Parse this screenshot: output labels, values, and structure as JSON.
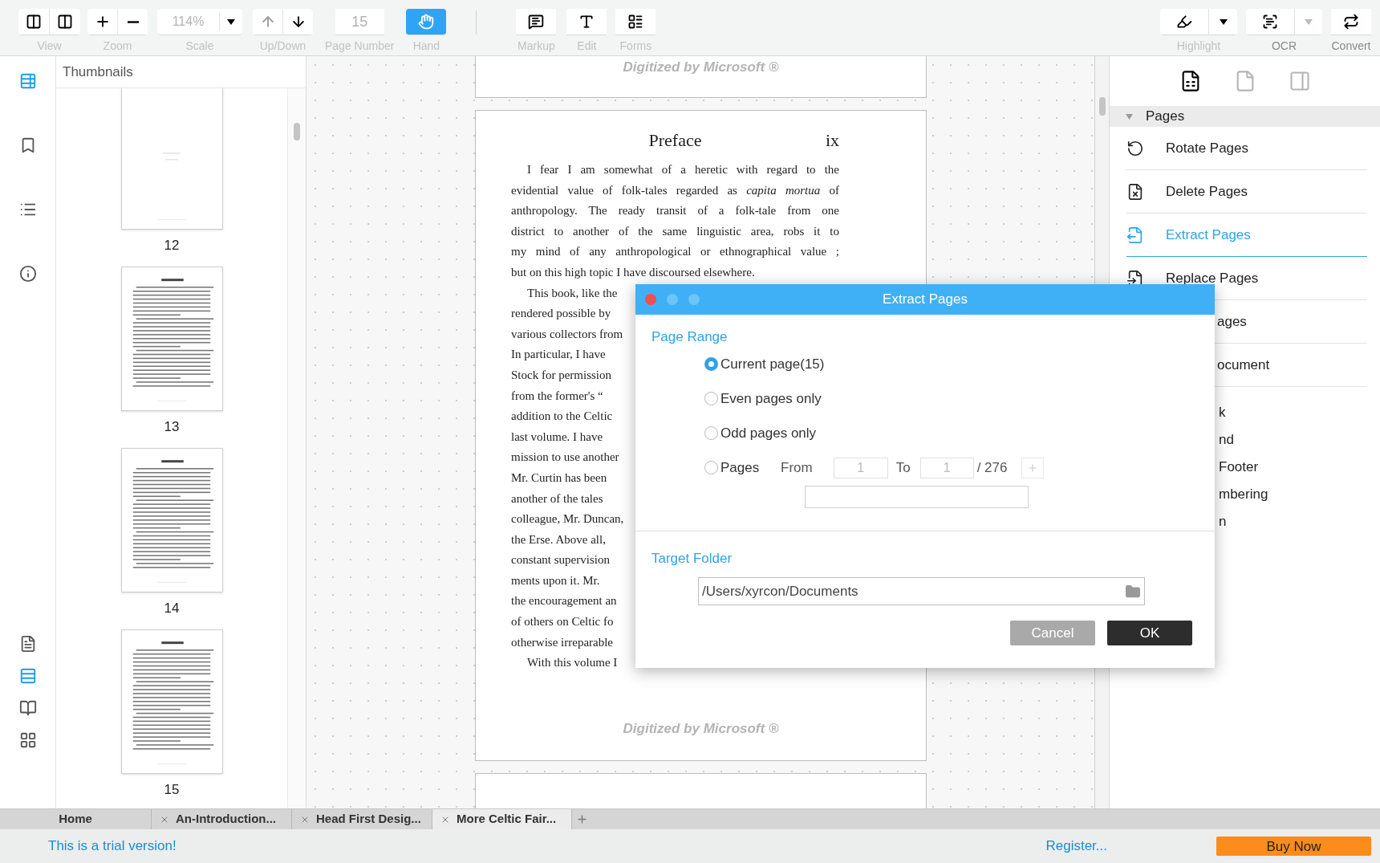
{
  "toolbar": {
    "left": [
      {
        "kind": "view",
        "label": "View",
        "disabled": true,
        "selected": false
      },
      {
        "kind": "zoom",
        "label": "Zoom",
        "disabled": true,
        "selected": false
      },
      {
        "kind": "scale",
        "label": "Scale",
        "value": "114%",
        "disabled": true,
        "selected": false
      },
      {
        "kind": "updown",
        "label": "Up/Down",
        "disabled": true,
        "selected": false
      },
      {
        "kind": "page",
        "label": "Page Number",
        "value": "15",
        "disabled": true,
        "selected": false
      },
      {
        "kind": "hand",
        "label": "Hand",
        "disabled": true,
        "selected": true
      }
    ],
    "middle": [
      {
        "kind": "markup",
        "label": "Markup",
        "disabled": true
      },
      {
        "kind": "edit",
        "label": "Edit",
        "disabled": true
      },
      {
        "kind": "forms",
        "label": "Forms",
        "disabled": true
      }
    ],
    "right": [
      {
        "kind": "highlight",
        "label": "Highlight",
        "disabled": true
      },
      {
        "kind": "ocr",
        "label": "OCR",
        "disabled": false
      },
      {
        "kind": "convert",
        "label": "Convert",
        "disabled": false
      }
    ]
  },
  "left_rail": {
    "top": [
      {
        "kind": "thumbnails",
        "selected": true
      },
      {
        "kind": "bookmarks",
        "selected": false
      },
      {
        "kind": "outline",
        "selected": false
      },
      {
        "kind": "info",
        "selected": false
      }
    ],
    "bottom": [
      {
        "kind": "single",
        "selected": false
      },
      {
        "kind": "continuous",
        "selected": true
      },
      {
        "kind": "facing",
        "selected": false
      },
      {
        "kind": "facing-continuous",
        "selected": false
      }
    ]
  },
  "thumbnails": {
    "title": "Thumbnails",
    "pages": [
      {
        "label": "12",
        "kind": "blank"
      },
      {
        "label": "13",
        "kind": "text"
      },
      {
        "label": "14",
        "kind": "text"
      },
      {
        "label": "15",
        "kind": "text"
      }
    ]
  },
  "document": {
    "top_page_watermark": "Digitized by Microsoft ®",
    "page": {
      "title": "Preface",
      "number": "ix",
      "watermark": "Digitized by Microsoft ®",
      "paragraphs": [
        {
          "covered": false,
          "lines": [
            "I fear I am somewhat of a heretic with regard to the",
            "evidential value of folk-tales regarded as *capita mortua* of",
            "anthropology. The ready transit of a folk-tale from one",
            "district to another of the same linguistic area, robs it to",
            "my mind of any anthropological or ethnographical value ;",
            "but on this high topic I have discoursed elsewhere."
          ]
        },
        {
          "covered": true,
          "lines": [
            "This book, like the",
            "rendered possible by",
            "various collectors from",
            "In particular, I have",
            "Stock for permission",
            "from the former's “",
            "addition to the Celtic",
            "last volume. I have",
            "mission to use another",
            "Mr. Curtin has been",
            "another of the tales",
            "colleague, Mr. Duncan,",
            "the Erse. Above all,",
            "constant supervision",
            "ments upon it. Mr.",
            "the encouragement an",
            "of others on Celtic fo",
            "otherwise irreparable"
          ]
        },
        {
          "covered": true,
          "lines": [
            "With this volume I"
          ]
        }
      ]
    }
  },
  "right_panel": {
    "tabs": [
      {
        "kind": "page-tools",
        "selected": true
      },
      {
        "kind": "document",
        "selected": false
      },
      {
        "kind": "export",
        "selected": false
      }
    ],
    "section": {
      "title": "Pages",
      "expanded": true,
      "items": [
        {
          "kind": "rotate",
          "label": "Rotate Pages",
          "selected": false
        },
        {
          "kind": "delete",
          "label": "Delete Pages",
          "selected": false
        },
        {
          "kind": "extract",
          "label": "Extract Pages",
          "selected": true
        },
        {
          "kind": "replace",
          "label": "Replace Pages",
          "selected": false
        },
        {
          "kind": "covered",
          "label": "ages",
          "selected": false
        },
        {
          "kind": "covered",
          "label": "ocument",
          "selected": false
        }
      ]
    },
    "more_items": [
      "k",
      "nd",
      "Footer",
      "mbering",
      "n"
    ]
  },
  "dialog": {
    "title": "Extract Pages",
    "page_range": {
      "heading": "Page Range",
      "options": [
        {
          "label": "Current page(15)",
          "selected": true
        },
        {
          "label": "Even pages only",
          "selected": false
        },
        {
          "label": "Odd pages only",
          "selected": false
        },
        {
          "label": "Pages",
          "selected": false
        }
      ],
      "from_label": "From",
      "from_value": "1",
      "to_label": "To",
      "to_value": "1",
      "total": "/ 276"
    },
    "target_folder": {
      "heading": "Target Folder",
      "path": "/Users/xyrcon/Documents"
    },
    "buttons": [
      {
        "label": "Cancel",
        "kind": "secondary"
      },
      {
        "label": "OK",
        "kind": "primary"
      }
    ]
  },
  "tabs": [
    {
      "label": "Home",
      "closable": false,
      "selected": false
    },
    {
      "label": "An-Introduction...",
      "closable": true,
      "selected": false
    },
    {
      "label": "Head First Desig...",
      "closable": true,
      "selected": false
    },
    {
      "label": "More Celtic Fair...",
      "closable": true,
      "selected": true
    }
  ],
  "status_bar": {
    "trial": "This is a trial version!",
    "register": "Register...",
    "buy": "Buy Now"
  }
}
